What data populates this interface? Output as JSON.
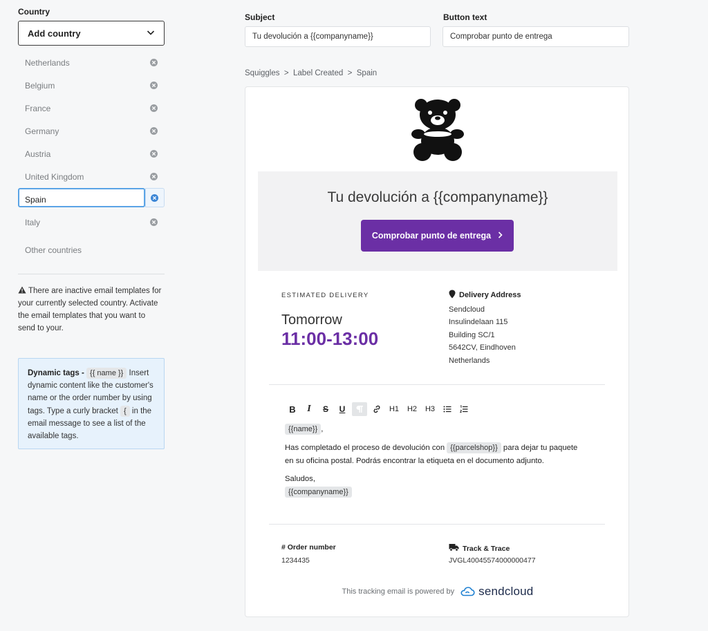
{
  "left": {
    "country_label": "Country",
    "add_country": "Add country",
    "countries": [
      "Netherlands",
      "Belgium",
      "France",
      "Germany",
      "Austria",
      "United Kingdom",
      "Spain",
      "Italy"
    ],
    "active_country": "Spain",
    "other_countries": "Other countries",
    "warning": "There are inactive email templates for your currently selected country. Activate the email templates that you want to send to your.",
    "tags_box": {
      "title": "Dynamic tags -",
      "chip": "{{ name }}",
      "text_1": "Insert dynamic content like the customer's name or the order number by using tags. Type a curly bracket",
      "bracket_chip": "{",
      "text_2": "in the email message to see a list of the available tags."
    }
  },
  "fields": {
    "subject_label": "Subject",
    "subject_value": "Tu devolución a {{companyname}}",
    "button_text_label": "Button text",
    "button_text_value": "Comprobar punto de entrega"
  },
  "breadcrumb": "Squiggles  >  Label Created  >  Spain",
  "email": {
    "hero_title": "Tu devolución a {{companyname}}",
    "hero_button": "Comprobar punto de entrega",
    "estimated_label": "ESTIMATED DELIVERY",
    "tomorrow": "Tomorrow",
    "time": "11:00-13:00",
    "address_label": "Delivery Address",
    "address_lines": [
      "Sendcloud",
      "Insulindelaan 115",
      "Building SC/1",
      "5642CV, Eindhoven",
      "Netherlands"
    ],
    "toolbar": {
      "bold": "B",
      "italic": "I",
      "strike": "S",
      "underline": "U",
      "h1": "H1",
      "h2": "H2",
      "h3": "H3"
    },
    "greeting_tag": "{{name}}",
    "greeting_suffix": ",",
    "paragraph_1a": "Has completado el proceso de devolución con",
    "parcelshop_tag": "{{parcelshop}}",
    "paragraph_1b": "para dejar tu paquete",
    "paragraph_1c": "en su oficina postal. Podrás encontrar la etiqueta en el documento adjunto.",
    "saludos": "Saludos,",
    "company_tag": "{{companyname}}",
    "order_label": "# Order number",
    "order_value": "1234435",
    "track_label": "Track & Trace",
    "track_value": "JVGL40045574000000477",
    "powered_by": "This tracking email is powered by",
    "brand_name": "sendcloud"
  },
  "colors": {
    "accent": "#6b2fa5",
    "selection_border": "#5aa4e6",
    "tags_bg": "#e7f2fc"
  }
}
